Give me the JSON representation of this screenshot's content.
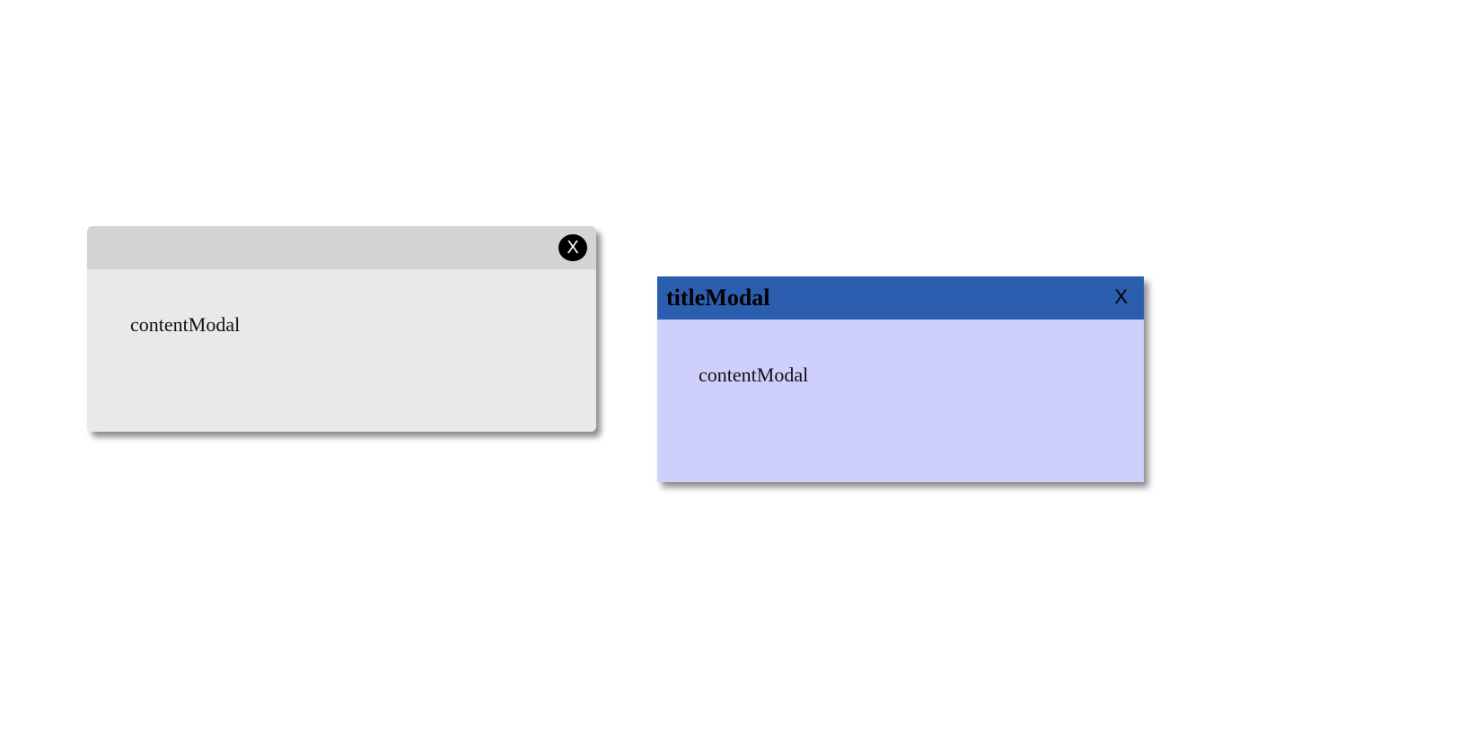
{
  "modals": [
    {
      "close_label": "X",
      "content": "contentModal",
      "colors": {
        "header": "#d5d4d2",
        "body": "#eae9e7",
        "close_button": "#000000"
      }
    },
    {
      "title": "titleModal",
      "close_label": "X",
      "content": "contentModal",
      "colors": {
        "header": "#2c5eb0",
        "body": "#cfcffc"
      }
    }
  ]
}
